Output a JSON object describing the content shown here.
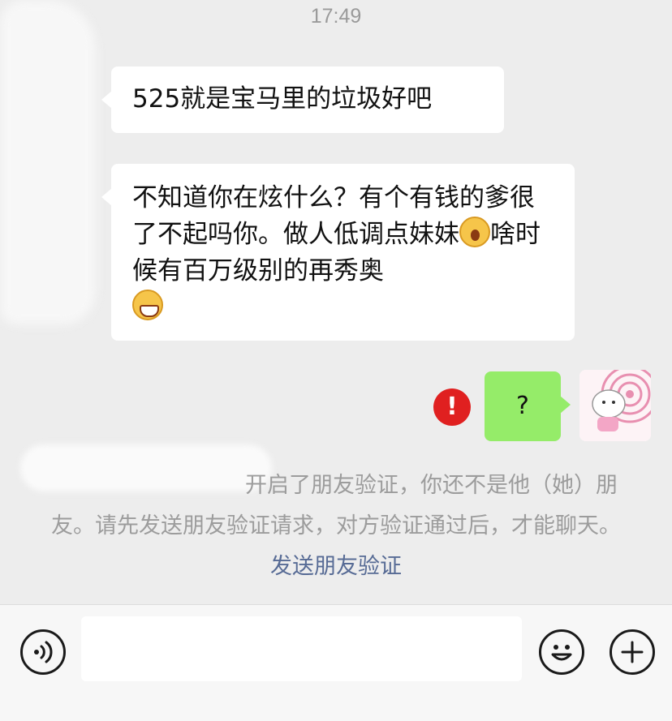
{
  "header": {
    "time": "17:49"
  },
  "messages": [
    {
      "side": "left",
      "text": "525就是宝马里的垃圾好吧"
    },
    {
      "side": "left",
      "parts": [
        "不知道你在炫什么？有个有钱的爹很了不起吗你。做人低调点妹妹",
        "啥时候有百万级别的再秀奥"
      ],
      "emojis": [
        "yawn-emoji",
        "grin-emoji"
      ]
    },
    {
      "side": "right",
      "text": "?",
      "status": "send-failed-icon"
    }
  ],
  "system_notice": {
    "text": "开启了朋友验证，你还不是他（她）朋友。请先发送朋友验证请求，对方验证通过后，才能聊天。",
    "link": "发送朋友验证"
  },
  "input_bar": {
    "voice_icon": "voice-icon",
    "emoji_icon": "emoji-icon",
    "plus_icon": "plus-icon",
    "input_value": ""
  },
  "colors": {
    "background": "#ededed",
    "self_bubble": "#95ec69",
    "link": "#576b95",
    "error": "#e02020"
  }
}
